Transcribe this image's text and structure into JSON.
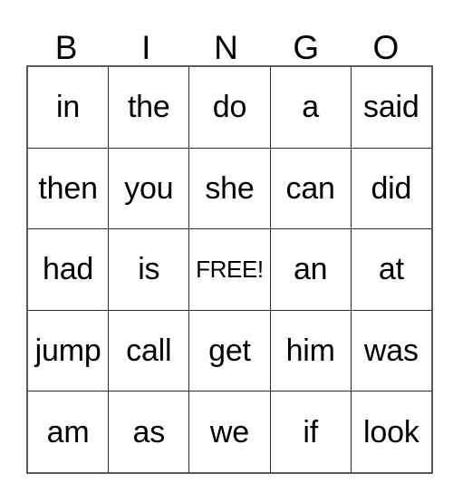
{
  "card": {
    "title": "BINGO",
    "headers": [
      "B",
      "I",
      "N",
      "G",
      "O"
    ],
    "free_space": {
      "label": "FREE!",
      "row": 2,
      "column": 2
    },
    "colors": {
      "background": "#ffffff",
      "text": "#000000",
      "grid_line": "#2b2b2b",
      "outer_border": "#595959"
    },
    "rows": [
      {
        "cells": [
          {
            "text": "in",
            "free": false
          },
          {
            "text": "the",
            "free": false
          },
          {
            "text": "do",
            "free": false
          },
          {
            "text": "a",
            "free": false
          },
          {
            "text": "said",
            "free": false
          }
        ]
      },
      {
        "cells": [
          {
            "text": "then",
            "free": false
          },
          {
            "text": "you",
            "free": false
          },
          {
            "text": "she",
            "free": false
          },
          {
            "text": "can",
            "free": false
          },
          {
            "text": "did",
            "free": false
          }
        ]
      },
      {
        "cells": [
          {
            "text": "had",
            "free": false
          },
          {
            "text": "is",
            "free": false
          },
          {
            "text": "FREE!",
            "free": true
          },
          {
            "text": "an",
            "free": false
          },
          {
            "text": "at",
            "free": false
          }
        ]
      },
      {
        "cells": [
          {
            "text": "jump",
            "free": false
          },
          {
            "text": "call",
            "free": false
          },
          {
            "text": "get",
            "free": false
          },
          {
            "text": "him",
            "free": false
          },
          {
            "text": "was",
            "free": false
          }
        ]
      },
      {
        "cells": [
          {
            "text": "am",
            "free": false
          },
          {
            "text": "as",
            "free": false
          },
          {
            "text": "we",
            "free": false
          },
          {
            "text": "if",
            "free": false
          },
          {
            "text": "look",
            "free": false
          }
        ]
      }
    ]
  }
}
